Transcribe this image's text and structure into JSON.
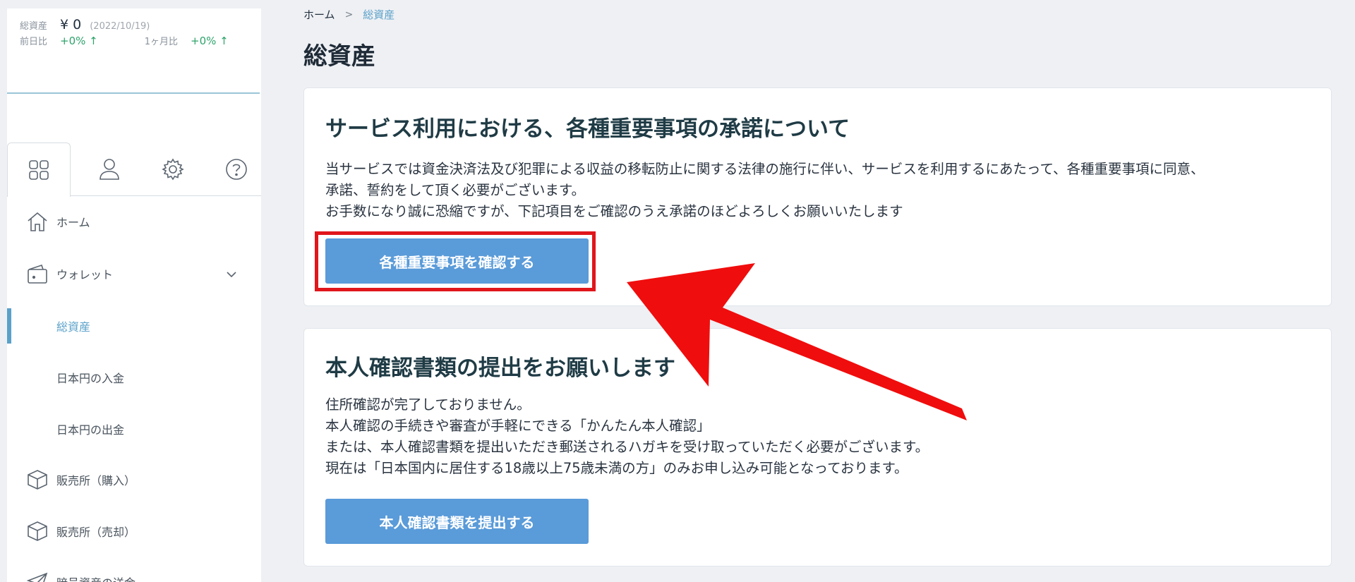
{
  "summary": {
    "total_label": "総資産",
    "total_amount": "¥ 0",
    "date": "(2022/10/19)",
    "day_label": "前日比",
    "day_change": "+0% ↑",
    "month_label": "1ヶ月比",
    "month_change": "+0% ↑"
  },
  "icon_tabs": [
    "grid-icon",
    "user-icon",
    "gear-icon",
    "help-icon"
  ],
  "sidebar": {
    "items": [
      {
        "label": "ホーム",
        "icon": "home-icon"
      },
      {
        "label": "ウォレット",
        "icon": "wallet-icon"
      },
      {
        "label": "総資産"
      },
      {
        "label": "日本円の入金"
      },
      {
        "label": "日本円の出金"
      },
      {
        "label": "販売所（購入）",
        "icon": "box-icon"
      },
      {
        "label": "販売所（売却）",
        "icon": "box-icon"
      },
      {
        "label": "暗号資産の送金",
        "icon": "send-icon"
      }
    ]
  },
  "breadcrumb": {
    "home": "ホーム",
    "separator": ">",
    "current": "総資産"
  },
  "page_title": "総資産",
  "card_terms": {
    "heading": "サービス利用における、各種重要事項の承諾について",
    "lines": [
      "当サービスでは資金決済法及び犯罪による収益の移転防止に関する法律の施行に伴い、サービスを利用するにあたって、各種重要事項に同意、",
      "承諾、誓約をして頂く必要がございます。",
      "お手数になり誠に恐縮ですが、下記項目をご確認のうえ承諾のほどよろしくお願いいたします"
    ],
    "button": "各種重要事項を確認する"
  },
  "card_identity": {
    "heading": "本人確認書類の提出をお願いします",
    "lines": [
      "住所確認が完了しておりません。",
      "本人確認の手続きや審査が手軽にできる「かんたん本人確認」",
      "または、本人確認書類を提出いただき郵送されるハガキを受け取っていただく必要がございます。",
      "現在は「日本国内に居住する18歳以上75歳未満の方」のみお申し込み可能となっております。"
    ],
    "button": "本人確認書類を提出する"
  },
  "colors": {
    "accent": "#5a9bd9",
    "sidebar_active": "#5aa1c9",
    "positive": "#2fa36b",
    "annotation": "#e0161b"
  }
}
